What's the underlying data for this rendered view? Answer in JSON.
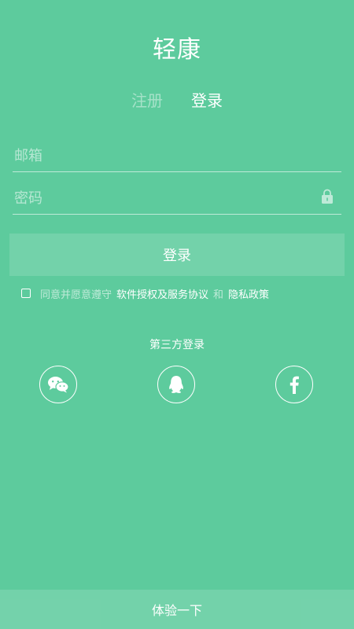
{
  "app": {
    "title": "轻康"
  },
  "tabs": {
    "register": "注册",
    "login": "登录"
  },
  "form": {
    "email_placeholder": "邮箱",
    "email_value": "",
    "password_placeholder": "密码",
    "password_value": ""
  },
  "login_button": "登录",
  "agreement": {
    "checked": false,
    "prefix": "同意并愿意遵守",
    "terms_link": "软件授权及服务协议",
    "and": "和",
    "privacy_link": "隐私政策"
  },
  "third_party": {
    "title": "第三方登录",
    "providers": [
      "wechat-icon",
      "qq-icon",
      "facebook-icon"
    ]
  },
  "try_button": "体验一下",
  "colors": {
    "background": "#5dcb9d",
    "text": "#ffffff"
  }
}
